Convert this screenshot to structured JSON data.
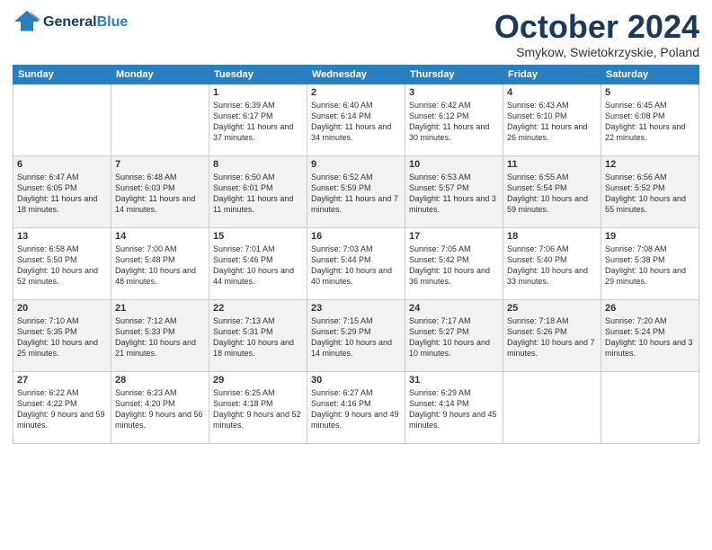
{
  "header": {
    "logo_general": "General",
    "logo_blue": "Blue",
    "title": "October 2024",
    "location": "Smykow, Swietokrzyskie, Poland"
  },
  "days_of_week": [
    "Sunday",
    "Monday",
    "Tuesday",
    "Wednesday",
    "Thursday",
    "Friday",
    "Saturday"
  ],
  "weeks": [
    [
      {
        "day": "",
        "sunrise": "",
        "sunset": "",
        "daylight": ""
      },
      {
        "day": "",
        "sunrise": "",
        "sunset": "",
        "daylight": ""
      },
      {
        "day": "1",
        "sunrise": "Sunrise: 6:39 AM",
        "sunset": "Sunset: 6:17 PM",
        "daylight": "Daylight: 11 hours and 37 minutes."
      },
      {
        "day": "2",
        "sunrise": "Sunrise: 6:40 AM",
        "sunset": "Sunset: 6:14 PM",
        "daylight": "Daylight: 11 hours and 34 minutes."
      },
      {
        "day": "3",
        "sunrise": "Sunrise: 6:42 AM",
        "sunset": "Sunset: 6:12 PM",
        "daylight": "Daylight: 11 hours and 30 minutes."
      },
      {
        "day": "4",
        "sunrise": "Sunrise: 6:43 AM",
        "sunset": "Sunset: 6:10 PM",
        "daylight": "Daylight: 11 hours and 26 minutes."
      },
      {
        "day": "5",
        "sunrise": "Sunrise: 6:45 AM",
        "sunset": "Sunset: 6:08 PM",
        "daylight": "Daylight: 11 hours and 22 minutes."
      }
    ],
    [
      {
        "day": "6",
        "sunrise": "Sunrise: 6:47 AM",
        "sunset": "Sunset: 6:05 PM",
        "daylight": "Daylight: 11 hours and 18 minutes."
      },
      {
        "day": "7",
        "sunrise": "Sunrise: 6:48 AM",
        "sunset": "Sunset: 6:03 PM",
        "daylight": "Daylight: 11 hours and 14 minutes."
      },
      {
        "day": "8",
        "sunrise": "Sunrise: 6:50 AM",
        "sunset": "Sunset: 6:01 PM",
        "daylight": "Daylight: 11 hours and 11 minutes."
      },
      {
        "day": "9",
        "sunrise": "Sunrise: 6:52 AM",
        "sunset": "Sunset: 5:59 PM",
        "daylight": "Daylight: 11 hours and 7 minutes."
      },
      {
        "day": "10",
        "sunrise": "Sunrise: 6:53 AM",
        "sunset": "Sunset: 5:57 PM",
        "daylight": "Daylight: 11 hours and 3 minutes."
      },
      {
        "day": "11",
        "sunrise": "Sunrise: 6:55 AM",
        "sunset": "Sunset: 5:54 PM",
        "daylight": "Daylight: 10 hours and 59 minutes."
      },
      {
        "day": "12",
        "sunrise": "Sunrise: 6:56 AM",
        "sunset": "Sunset: 5:52 PM",
        "daylight": "Daylight: 10 hours and 55 minutes."
      }
    ],
    [
      {
        "day": "13",
        "sunrise": "Sunrise: 6:58 AM",
        "sunset": "Sunset: 5:50 PM",
        "daylight": "Daylight: 10 hours and 52 minutes."
      },
      {
        "day": "14",
        "sunrise": "Sunrise: 7:00 AM",
        "sunset": "Sunset: 5:48 PM",
        "daylight": "Daylight: 10 hours and 48 minutes."
      },
      {
        "day": "15",
        "sunrise": "Sunrise: 7:01 AM",
        "sunset": "Sunset: 5:46 PM",
        "daylight": "Daylight: 10 hours and 44 minutes."
      },
      {
        "day": "16",
        "sunrise": "Sunrise: 7:03 AM",
        "sunset": "Sunset: 5:44 PM",
        "daylight": "Daylight: 10 hours and 40 minutes."
      },
      {
        "day": "17",
        "sunrise": "Sunrise: 7:05 AM",
        "sunset": "Sunset: 5:42 PM",
        "daylight": "Daylight: 10 hours and 36 minutes."
      },
      {
        "day": "18",
        "sunrise": "Sunrise: 7:06 AM",
        "sunset": "Sunset: 5:40 PM",
        "daylight": "Daylight: 10 hours and 33 minutes."
      },
      {
        "day": "19",
        "sunrise": "Sunrise: 7:08 AM",
        "sunset": "Sunset: 5:38 PM",
        "daylight": "Daylight: 10 hours and 29 minutes."
      }
    ],
    [
      {
        "day": "20",
        "sunrise": "Sunrise: 7:10 AM",
        "sunset": "Sunset: 5:35 PM",
        "daylight": "Daylight: 10 hours and 25 minutes."
      },
      {
        "day": "21",
        "sunrise": "Sunrise: 7:12 AM",
        "sunset": "Sunset: 5:33 PM",
        "daylight": "Daylight: 10 hours and 21 minutes."
      },
      {
        "day": "22",
        "sunrise": "Sunrise: 7:13 AM",
        "sunset": "Sunset: 5:31 PM",
        "daylight": "Daylight: 10 hours and 18 minutes."
      },
      {
        "day": "23",
        "sunrise": "Sunrise: 7:15 AM",
        "sunset": "Sunset: 5:29 PM",
        "daylight": "Daylight: 10 hours and 14 minutes."
      },
      {
        "day": "24",
        "sunrise": "Sunrise: 7:17 AM",
        "sunset": "Sunset: 5:27 PM",
        "daylight": "Daylight: 10 hours and 10 minutes."
      },
      {
        "day": "25",
        "sunrise": "Sunrise: 7:18 AM",
        "sunset": "Sunset: 5:26 PM",
        "daylight": "Daylight: 10 hours and 7 minutes."
      },
      {
        "day": "26",
        "sunrise": "Sunrise: 7:20 AM",
        "sunset": "Sunset: 5:24 PM",
        "daylight": "Daylight: 10 hours and 3 minutes."
      }
    ],
    [
      {
        "day": "27",
        "sunrise": "Sunrise: 6:22 AM",
        "sunset": "Sunset: 4:22 PM",
        "daylight": "Daylight: 9 hours and 59 minutes."
      },
      {
        "day": "28",
        "sunrise": "Sunrise: 6:23 AM",
        "sunset": "Sunset: 4:20 PM",
        "daylight": "Daylight: 9 hours and 56 minutes."
      },
      {
        "day": "29",
        "sunrise": "Sunrise: 6:25 AM",
        "sunset": "Sunset: 4:18 PM",
        "daylight": "Daylight: 9 hours and 52 minutes."
      },
      {
        "day": "30",
        "sunrise": "Sunrise: 6:27 AM",
        "sunset": "Sunset: 4:16 PM",
        "daylight": "Daylight: 9 hours and 49 minutes."
      },
      {
        "day": "31",
        "sunrise": "Sunrise: 6:29 AM",
        "sunset": "Sunset: 4:14 PM",
        "daylight": "Daylight: 9 hours and 45 minutes."
      },
      {
        "day": "",
        "sunrise": "",
        "sunset": "",
        "daylight": ""
      },
      {
        "day": "",
        "sunrise": "",
        "sunset": "",
        "daylight": ""
      }
    ]
  ]
}
